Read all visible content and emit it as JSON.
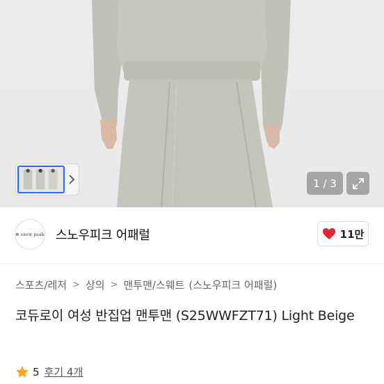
{
  "gallery": {
    "counter": "1 / 3",
    "thumbnail_next_icon": "chevron-right-icon",
    "expand_icon": "expand-arrows-icon"
  },
  "shop": {
    "logo_text": "✻ snow peak",
    "name": "스노우피크 어패럴",
    "like_icon": "heart-icon",
    "like_color": "#e8203a",
    "like_count": "11만"
  },
  "breadcrumb": [
    "스포츠/레저",
    "상의",
    "맨투맨/스웨트",
    "(스노우피크 어패럴)"
  ],
  "product": {
    "title": "코듀로이 여성 반집업 맨투맨 (S25WWFZT71) Light Beige"
  },
  "rating": {
    "star_icon": "star-icon",
    "star_color": "#f5a623",
    "score": "5",
    "review_label": "후기 4개"
  }
}
